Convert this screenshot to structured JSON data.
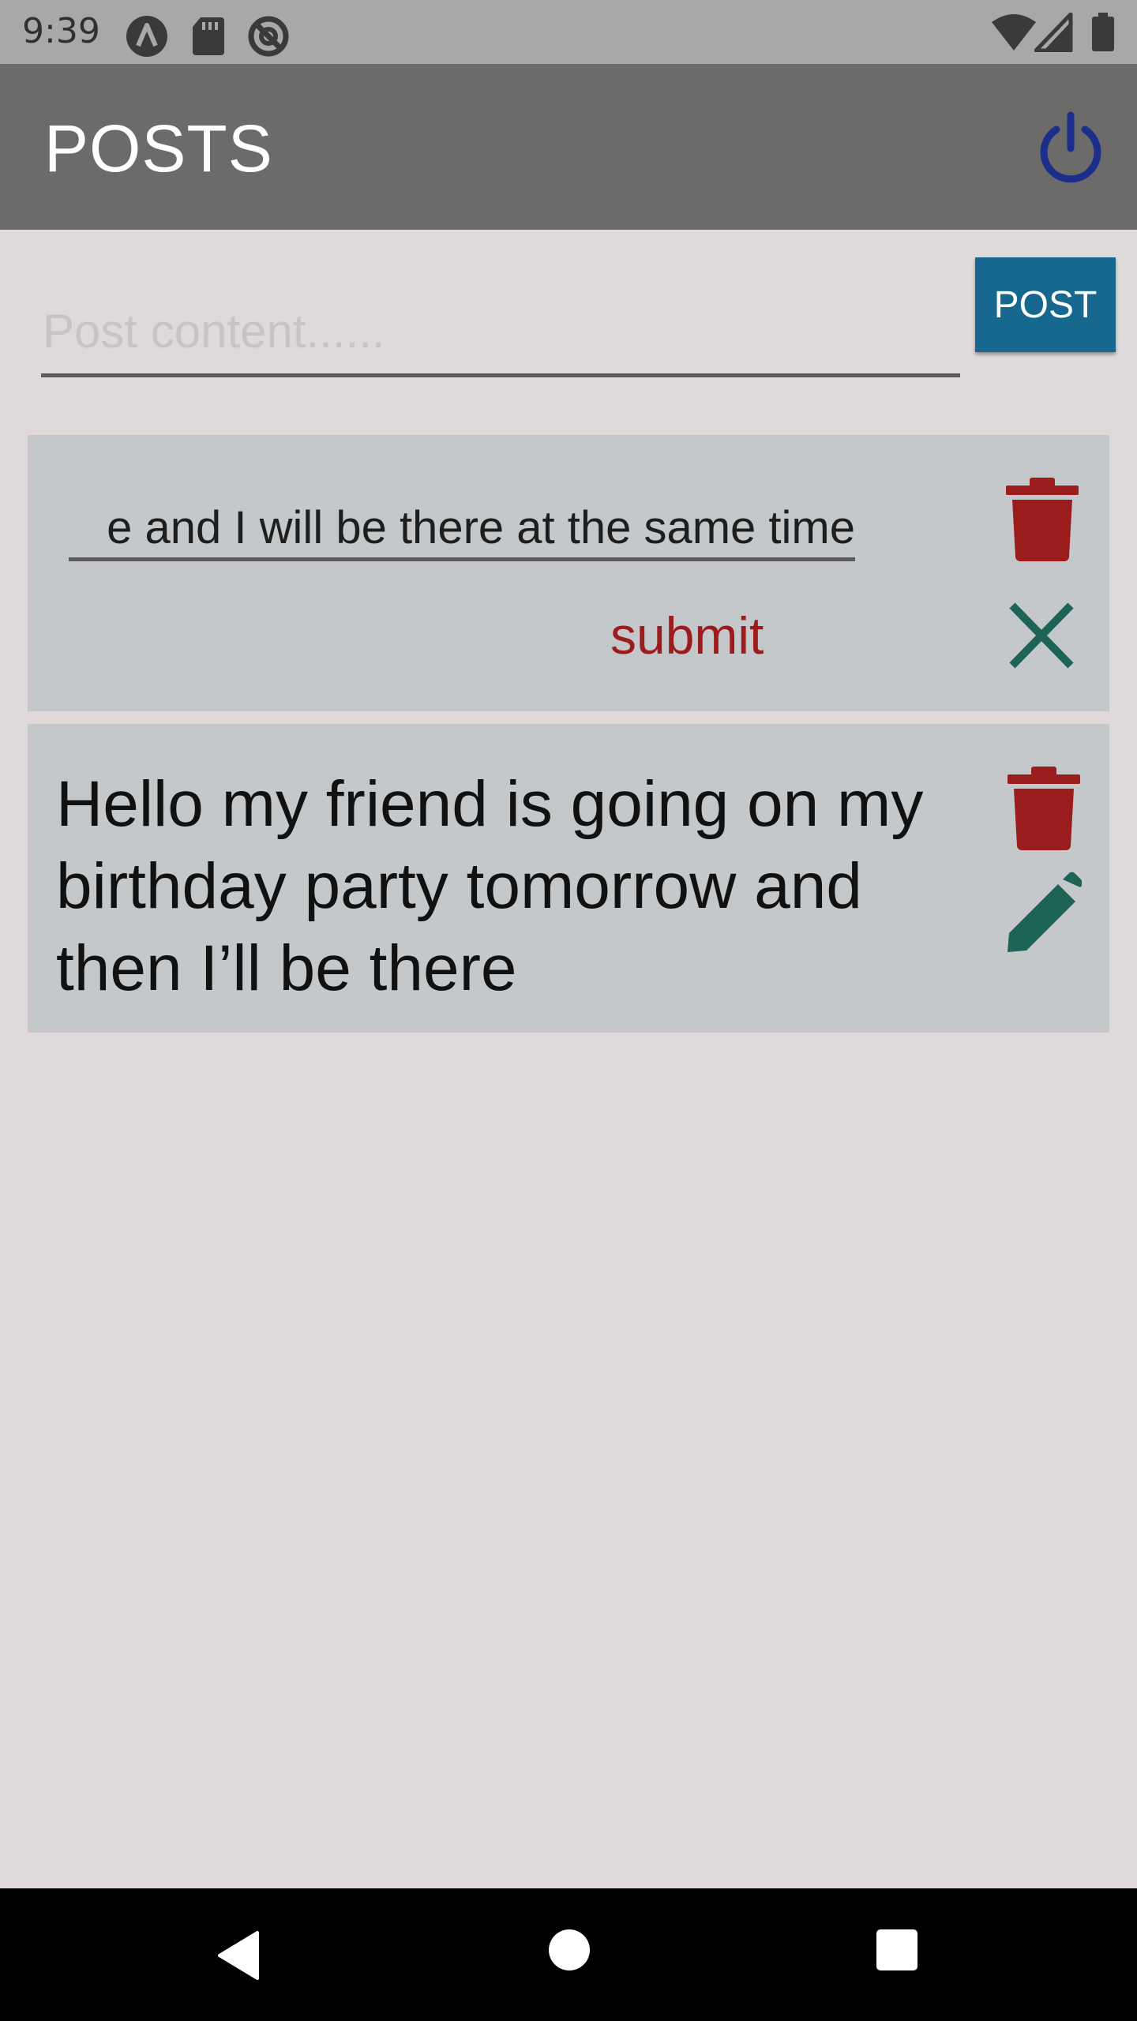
{
  "status_bar": {
    "time": "9:39",
    "icons": [
      "a-icon",
      "sd-card-icon",
      "no-sync-icon",
      "wifi-icon",
      "signal-icon",
      "battery-icon"
    ]
  },
  "app_bar": {
    "title": "POSTS",
    "power_icon": "power-icon",
    "power_color": "#1a2e8a"
  },
  "composer": {
    "placeholder": "Post content......",
    "value": "",
    "post_label": "POST",
    "post_color": "#17688f"
  },
  "posts": [
    {
      "mode": "editing",
      "edit_value": "e and I will be there at the same time",
      "submit_label": "submit",
      "actions": [
        "delete-icon",
        "close-icon"
      ]
    },
    {
      "mode": "view",
      "text": "Hello my friend is going on my birthday party tomorrow and then I’ll be there",
      "actions": [
        "delete-icon",
        "edit-icon"
      ]
    }
  ],
  "colors": {
    "delete": "#9a1c1c",
    "action_green": "#1e6456",
    "card_bg": "#c4c8ca",
    "page_bg": "#dfd9da"
  },
  "nav_bar": {
    "buttons": [
      "back-icon",
      "home-icon",
      "recents-icon"
    ]
  }
}
